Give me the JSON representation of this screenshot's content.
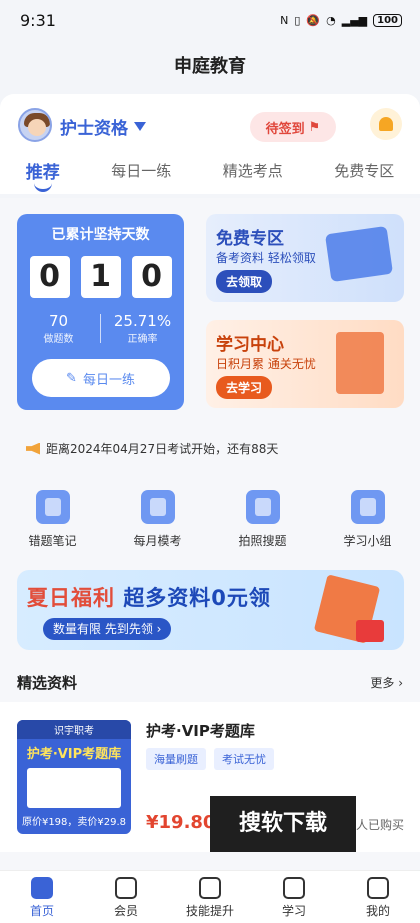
{
  "status": {
    "time": "9:31",
    "battery": "100"
  },
  "app": {
    "title": "申庭教育"
  },
  "header": {
    "cert": "护士资格",
    "signin": "待签到"
  },
  "tabs": [
    "推荐",
    "每日一练",
    "精选考点",
    "免费专区"
  ],
  "stats": {
    "title": "已累计坚持天数",
    "digits": [
      "0",
      "1",
      "0"
    ],
    "done": "70",
    "done_label": "做题数",
    "accuracy": "25.71%",
    "accuracy_label": "正确率",
    "button": "每日一练"
  },
  "promos": {
    "free": {
      "title": "免费专区",
      "sub": "备考资料 轻松领取",
      "button": "去领取"
    },
    "study": {
      "title": "学习中心",
      "sub": "日积月累 通关无忧",
      "button": "去学习"
    }
  },
  "notice": "距离2024年04月27日考试开始，还有88天",
  "quick": [
    "错题笔记",
    "每月模考",
    "拍照搜题",
    "学习小组"
  ],
  "banner": {
    "title_a": "夏日福利",
    "title_b": "超多资料0元领",
    "pill": "数量有限 先到先领"
  },
  "section": {
    "title": "精选资料",
    "more": "更多"
  },
  "product": {
    "cover_top": "识宇职考",
    "cover_title": "护考·VIP考题库",
    "cover_bottom": "原价¥198，卖价¥29.8",
    "title": "护考·VIP考题库",
    "tags": [
      "海量刷题",
      "考试无忧"
    ],
    "price": "¥19.80",
    "buyers": "人已购买"
  },
  "watermark": "搜软下载",
  "nav": [
    "首页",
    "会员",
    "技能提升",
    "学习",
    "我的"
  ],
  "colors": {
    "accent": "#3a63d6",
    "price": "#e2452f"
  }
}
